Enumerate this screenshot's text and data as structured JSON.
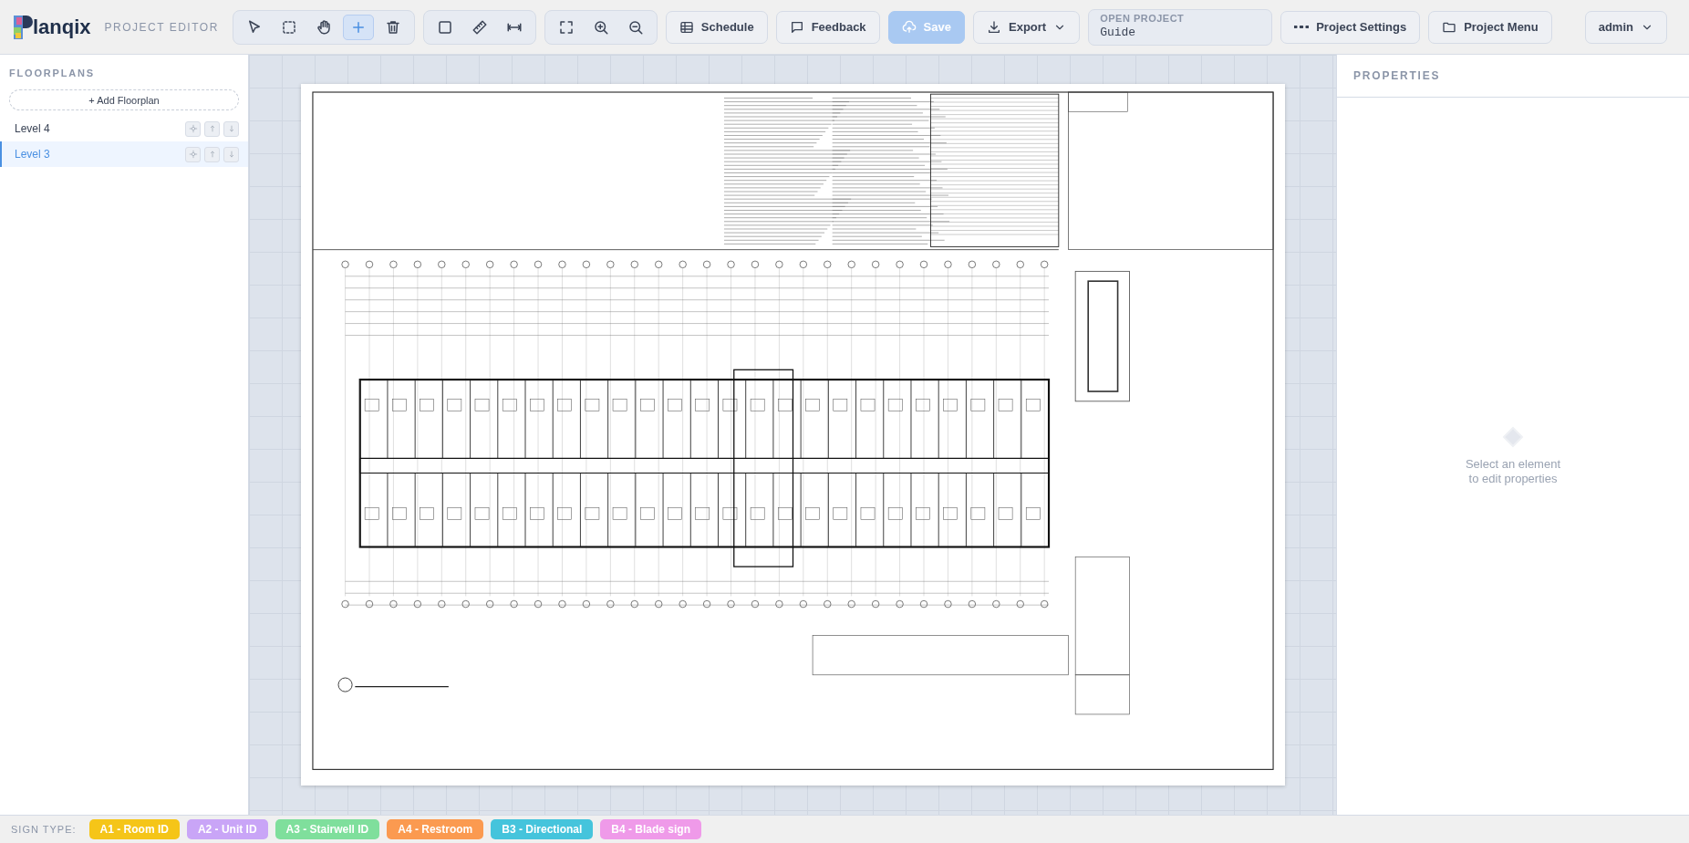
{
  "app": {
    "logo_text": "lanqix",
    "section_label": "PROJECT EDITOR"
  },
  "toolbar_groups": [
    {
      "tools": [
        {
          "kind": "pointer",
          "selected": false
        },
        {
          "kind": "marquee",
          "selected": false
        },
        {
          "kind": "hand",
          "selected": false
        },
        {
          "kind": "plus",
          "selected": true
        },
        {
          "kind": "trash",
          "selected": false
        }
      ]
    },
    {
      "tools": [
        {
          "kind": "rectangle",
          "selected": false
        },
        {
          "kind": "ruler",
          "selected": false
        },
        {
          "kind": "measure",
          "selected": false
        }
      ]
    },
    {
      "tools": [
        {
          "kind": "fit",
          "selected": false
        },
        {
          "kind": "zoom-in",
          "selected": false
        },
        {
          "kind": "zoom-out",
          "selected": false
        }
      ]
    }
  ],
  "actions": [
    {
      "kind": "schedule",
      "label": "Schedule",
      "disabled": false
    },
    {
      "kind": "feedback",
      "label": "Feedback",
      "disabled": false
    },
    {
      "kind": "save",
      "label": "Save",
      "disabled": true
    },
    {
      "kind": "export",
      "label": "Export",
      "disabled": false
    }
  ],
  "open_project": {
    "label": "OPEN PROJECT",
    "value": "Guide"
  },
  "menu_buttons": [
    {
      "kind": "settings",
      "label": "Project Settings"
    },
    {
      "kind": "folder",
      "label": "Project Menu"
    }
  ],
  "user_menu": {
    "label": "admin"
  },
  "sidebar": {
    "title": "FLOORPLANS",
    "add_button": "+ Add Floorplan",
    "items": [
      {
        "label": "Level 4",
        "selected": false
      },
      {
        "label": "Level 3",
        "selected": true
      }
    ]
  },
  "properties": {
    "title": "PROPERTIES",
    "empty_message": "Select an element to edit properties"
  },
  "sign_types": {
    "label": "SIGN TYPE:",
    "items": [
      {
        "label": "A1 - Room ID",
        "color": "#f5c518"
      },
      {
        "label": "A2 - Unit ID",
        "color": "#c9a5f7"
      },
      {
        "label": "A3 - Stairwell ID",
        "color": "#7fdf9c"
      },
      {
        "label": "A4 - Restroom",
        "color": "#fb9a50"
      },
      {
        "label": "B3 - Directional",
        "color": "#45c4dc"
      },
      {
        "label": "B4 - Blade sign",
        "color": "#ef9ae9"
      }
    ]
  }
}
